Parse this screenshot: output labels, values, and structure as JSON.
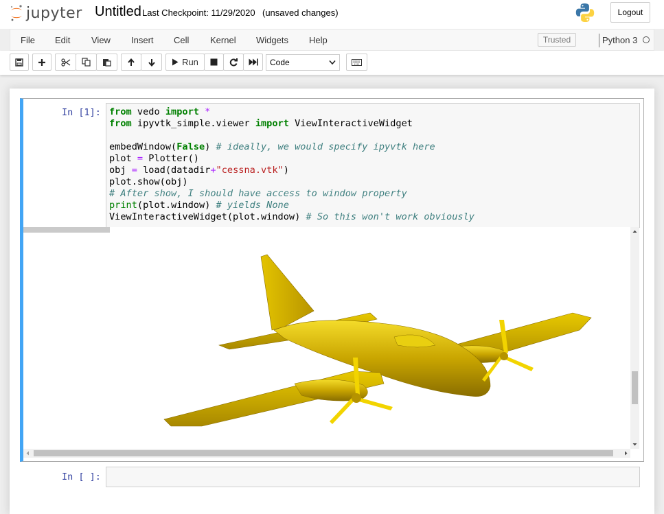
{
  "header": {
    "logo_text": "jupyter",
    "notebook_title": "Untitled",
    "checkpoint": "Last Checkpoint: 11/29/2020",
    "unsaved": "(unsaved changes)",
    "logout_label": "Logout"
  },
  "menubar": {
    "items": [
      "File",
      "Edit",
      "View",
      "Insert",
      "Cell",
      "Kernel",
      "Widgets",
      "Help"
    ],
    "trusted_label": "Trusted",
    "kernel_name": "Python 3"
  },
  "toolbar": {
    "buttons": [
      "save-icon",
      "plus-icon",
      "cut-icon",
      "copy-icon",
      "paste-icon",
      "arrow-up-icon",
      "arrow-down-icon",
      "run-icon",
      "stop-icon",
      "restart-icon",
      "fast-forward-icon",
      "keyboard-icon"
    ],
    "run_label": "Run",
    "cell_type": "Code"
  },
  "cells": [
    {
      "prompt": "In [1]:",
      "code_lines": [
        "from vedo import *",
        "from ipyvtk_simple.viewer import ViewInteractiveWidget",
        "",
        "embedWindow(False) # ideally, we would specify ipyvtk here",
        "plot = Plotter()",
        "obj = load(datadir+\"cessna.vtk\")",
        "plot.show(obj)",
        "# After show, I should have access to window property",
        "print(plot.window) # yields None",
        "ViewInteractiveWidget(plot.window) # So this won't work obviously"
      ],
      "output": "cessna-airplane-render"
    },
    {
      "prompt": "In [ ]:",
      "code_lines": []
    }
  ],
  "colors": {
    "selected_cell_bar": "#42a5f5",
    "prompt": "#303f9f",
    "keyword": "#008000",
    "comment": "#408080",
    "string": "#ba2121",
    "operator": "#aa22ff",
    "airplane": "#d4b200"
  }
}
